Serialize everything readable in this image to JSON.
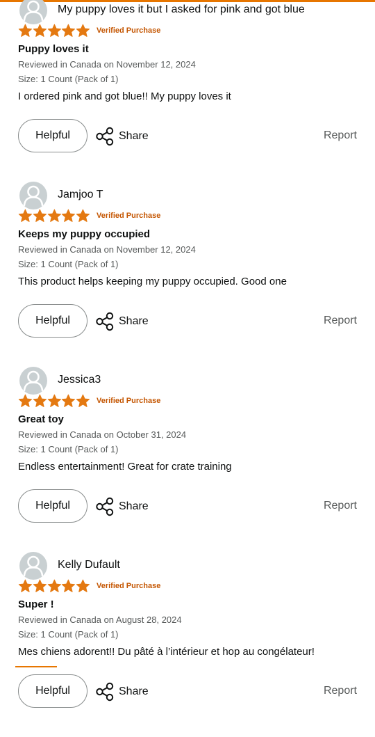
{
  "colors": {
    "star": "#e47911",
    "verified": "#c45500",
    "top_bar": "#e77600",
    "avatar_bg": "#c9d0d2",
    "avatar_fg": "#ffffff"
  },
  "loading_progress": 1.0,
  "icons": {
    "star": "star-icon",
    "share": "share-icon",
    "avatar": "user-avatar-icon"
  },
  "reviews": [
    {
      "name": "My puppy loves it but I asked for pink and got blue",
      "rating": 5,
      "verified": "Verified Purchase",
      "title": "Puppy loves it",
      "date": "Reviewed in Canada on November 12, 2024",
      "size": "Size: 1 Count (Pack of 1)",
      "body": "I ordered pink and got blue!! My puppy loves it",
      "helpful": "Helpful",
      "share": "Share",
      "report": "Report"
    },
    {
      "name": "Jamjoo T",
      "rating": 5,
      "verified": "Verified Purchase",
      "title": "Keeps my puppy occupied",
      "date": "Reviewed in Canada on November 12, 2024",
      "size": "Size: 1 Count (Pack of 1)",
      "body": "This product helps keeping my puppy occupied. Good one",
      "helpful": "Helpful",
      "share": "Share",
      "report": "Report"
    },
    {
      "name": "Jessica3",
      "rating": 5,
      "verified": "Verified Purchase",
      "title": "Great toy",
      "date": "Reviewed in Canada on October 31, 2024",
      "size": "Size: 1 Count (Pack of 1)",
      "body": "Endless entertainment! Great for crate training",
      "helpful": "Helpful",
      "share": "Share",
      "report": "Report"
    },
    {
      "name": "Kelly Dufault",
      "rating": 5,
      "verified": "Verified Purchase",
      "title": "Super !",
      "date": "Reviewed in Canada on August 28, 2024",
      "size": "Size: 1 Count (Pack of 1)",
      "body": "Mes chiens adorent!! Du pâté à l’intérieur et hop au congélateur!",
      "helpful": "Helpful",
      "share": "Share",
      "report": "Report"
    }
  ]
}
